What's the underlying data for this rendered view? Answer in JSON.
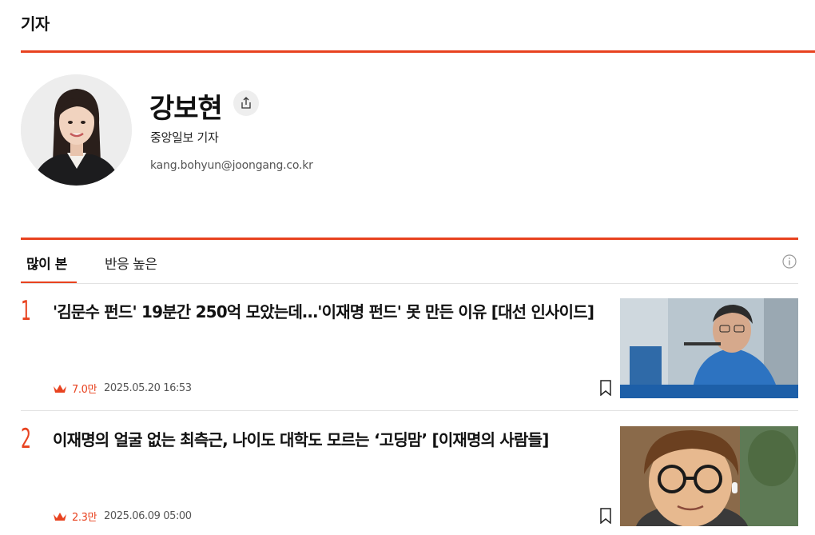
{
  "section": {
    "title": "기자"
  },
  "reporter": {
    "name": "강보현",
    "affiliation": "중앙일보 기자",
    "email": "kang.bohyun@joongang.co.kr"
  },
  "tabs": [
    {
      "label": "많이 본",
      "active": true
    },
    {
      "label": "반응 높은",
      "active": false
    }
  ],
  "articles": [
    {
      "rank": "1",
      "headline": "'김문수 펀드' 19분간 250억 모았는데…'이재명 펀드' 못 만든 이유 [대선 인사이드]",
      "views": "7.0만",
      "date": "2025.05.20 16:53"
    },
    {
      "rank": "2",
      "headline": "이재명의 얼굴 없는 최측근, 나이도 대학도 모르는 ‘고딩맘’ [이재명의 사람들]",
      "views": "2.3만",
      "date": "2025.06.09 05:00"
    }
  ],
  "colors": {
    "accent": "#e8421f",
    "text": "#111111",
    "muted": "#555555"
  },
  "icons": [
    "share-icon",
    "info-icon",
    "crown-icon",
    "bookmark-icon"
  ]
}
